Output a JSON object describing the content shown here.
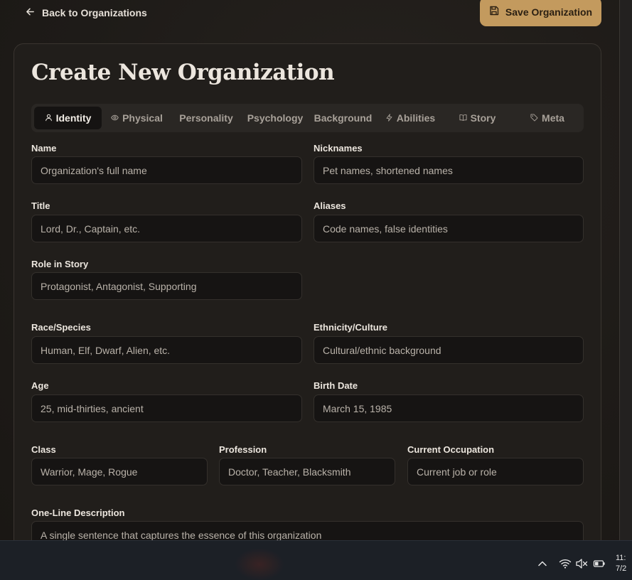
{
  "header": {
    "back_label": "Back to Organizations",
    "save_label": "Save Organization"
  },
  "page": {
    "title": "Create New Organization"
  },
  "tabs": [
    {
      "label": "Identity",
      "icon": "user-icon",
      "active": true
    },
    {
      "label": "Physical",
      "icon": "eye-icon",
      "active": false
    },
    {
      "label": "Personality",
      "icon": "",
      "active": false
    },
    {
      "label": "Psychology",
      "icon": "",
      "active": false
    },
    {
      "label": "Background",
      "icon": "",
      "active": false
    },
    {
      "label": "Abilities",
      "icon": "lightning-icon",
      "active": false
    },
    {
      "label": "Story",
      "icon": "book-icon",
      "active": false
    },
    {
      "label": "Meta",
      "icon": "tag-icon",
      "active": false
    }
  ],
  "fields": {
    "name": {
      "label": "Name",
      "placeholder": "Organization's full name"
    },
    "nicknames": {
      "label": "Nicknames",
      "placeholder": "Pet names, shortened names"
    },
    "title": {
      "label": "Title",
      "placeholder": "Lord, Dr., Captain, etc."
    },
    "aliases": {
      "label": "Aliases",
      "placeholder": "Code names, false identities"
    },
    "role": {
      "label": "Role in Story",
      "placeholder": "Protagonist, Antagonist, Supporting"
    },
    "race": {
      "label": "Race/Species",
      "placeholder": "Human, Elf, Dwarf, Alien, etc."
    },
    "ethnicity": {
      "label": "Ethnicity/Culture",
      "placeholder": "Cultural/ethnic background"
    },
    "age": {
      "label": "Age",
      "placeholder": "25, mid-thirties, ancient"
    },
    "birth_date": {
      "label": "Birth Date",
      "placeholder": "March 15, 1985"
    },
    "class": {
      "label": "Class",
      "placeholder": "Warrior, Mage, Rogue"
    },
    "profession": {
      "label": "Profession",
      "placeholder": "Doctor, Teacher, Blacksmith"
    },
    "occupation": {
      "label": "Current Occupation",
      "placeholder": "Current job or role"
    },
    "description": {
      "label": "One-Line Description",
      "placeholder": "A single sentence that captures the essence of this organization"
    }
  },
  "taskbar": {
    "time": "11:",
    "date": "7/2"
  },
  "colors": {
    "accent": "#c39a5e",
    "background": "#1d1a17",
    "card": "#211e1b",
    "input": "#161413"
  }
}
